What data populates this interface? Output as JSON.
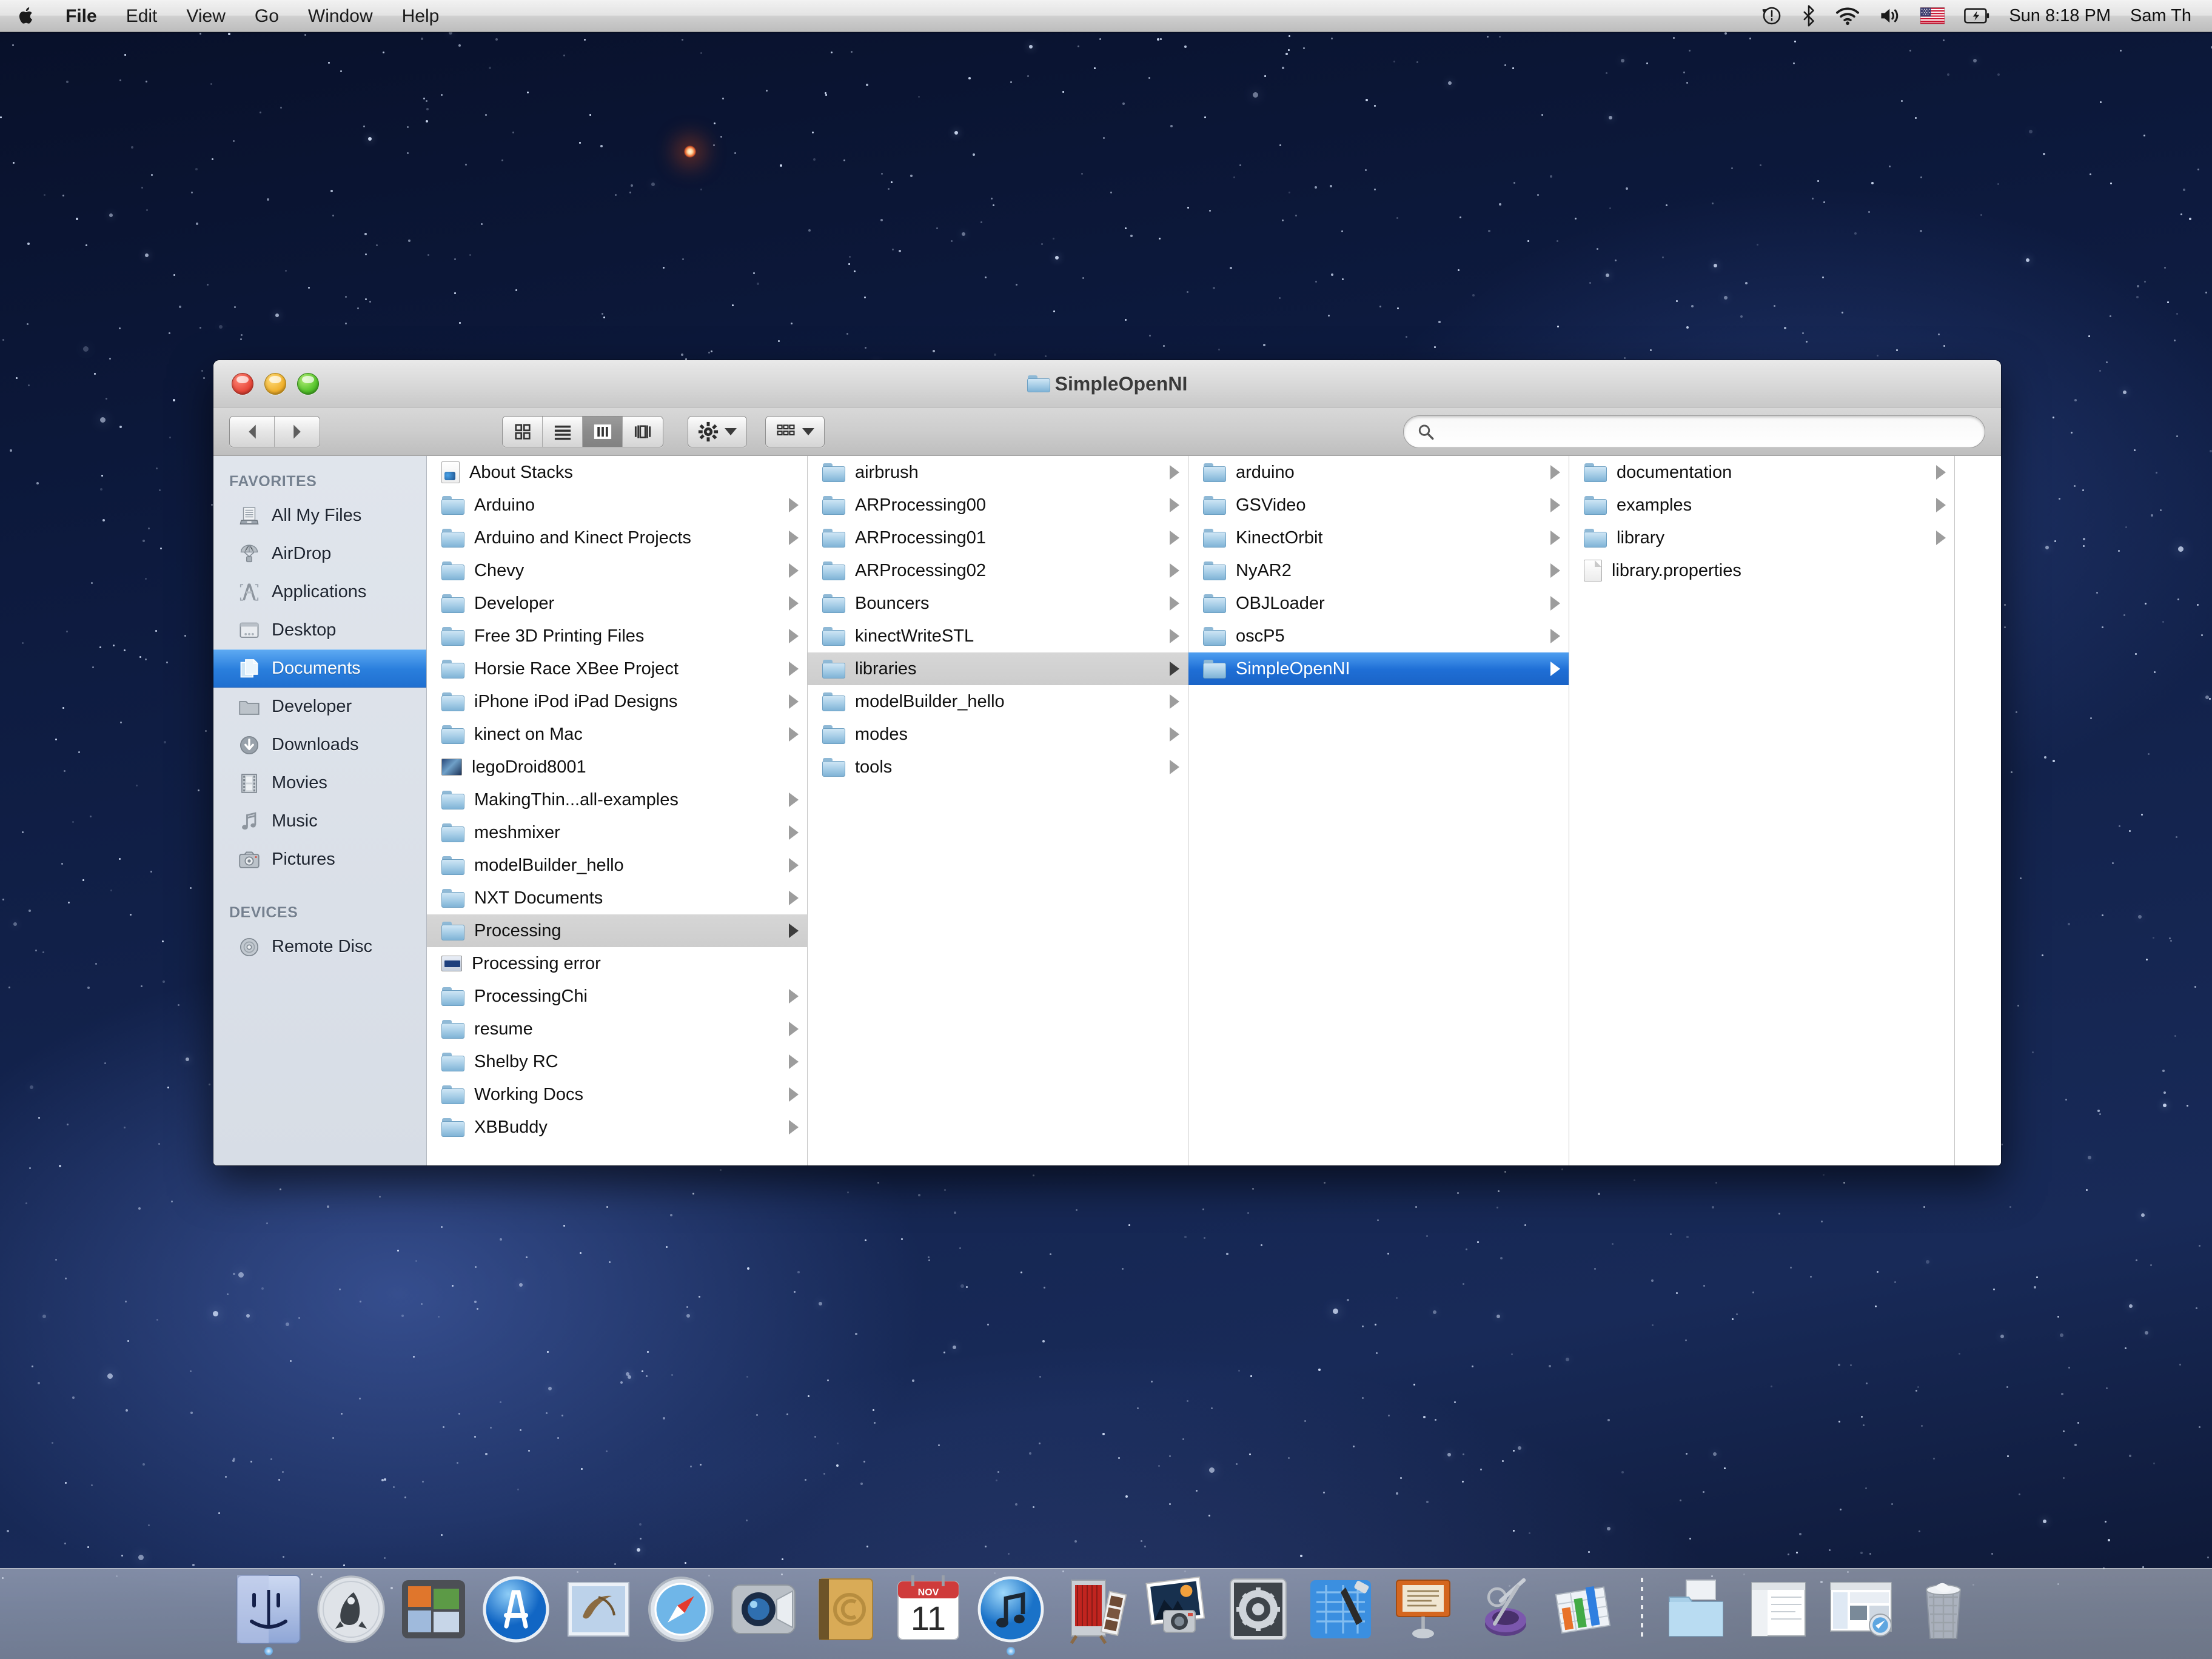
{
  "menubar": {
    "apple_icon": "apple-logo-icon",
    "items": [
      {
        "label": "File",
        "bold": true
      },
      {
        "label": "Edit",
        "bold": false
      },
      {
        "label": "View",
        "bold": false
      },
      {
        "label": "Go",
        "bold": false
      },
      {
        "label": "Window",
        "bold": false
      },
      {
        "label": "Help",
        "bold": false
      }
    ],
    "status_icons": [
      "timemachine-icon",
      "bluetooth-icon",
      "wifi-icon",
      "volume-icon",
      "us-flag-input-icon",
      "battery-icon"
    ],
    "clock": "Sun 8:18 PM",
    "user": "Sam Th"
  },
  "window": {
    "title": "SimpleOpenNI",
    "title_icon": "folder-icon",
    "traffic_lights": [
      "close-button",
      "minimize-button",
      "zoom-button"
    ]
  },
  "toolbar": {
    "back_label": "Back",
    "forward_label": "Forward",
    "view_modes": [
      {
        "name": "icon-view",
        "active": false
      },
      {
        "name": "list-view",
        "active": false
      },
      {
        "name": "column-view",
        "active": true
      },
      {
        "name": "coverflow-view",
        "active": false
      }
    ],
    "action_menu_label": "Action",
    "arrange_menu_label": "Arrange"
  },
  "search": {
    "value": "",
    "placeholder": ""
  },
  "sidebar": {
    "sections": [
      {
        "header": "FAVORITES",
        "items": [
          {
            "label": "All My Files",
            "icon": "all-my-files-icon",
            "selected": false
          },
          {
            "label": "AirDrop",
            "icon": "airdrop-icon",
            "selected": false
          },
          {
            "label": "Applications",
            "icon": "applications-icon",
            "selected": false
          },
          {
            "label": "Desktop",
            "icon": "desktop-icon",
            "selected": false
          },
          {
            "label": "Documents",
            "icon": "documents-icon",
            "selected": true
          },
          {
            "label": "Developer",
            "icon": "folder-icon",
            "selected": false
          },
          {
            "label": "Downloads",
            "icon": "downloads-icon",
            "selected": false
          },
          {
            "label": "Movies",
            "icon": "movies-icon",
            "selected": false
          },
          {
            "label": "Music",
            "icon": "music-icon",
            "selected": false
          },
          {
            "label": "Pictures",
            "icon": "pictures-icon",
            "selected": false
          }
        ]
      },
      {
        "header": "DEVICES",
        "items": [
          {
            "label": "Remote Disc",
            "icon": "remote-disc-icon",
            "selected": false
          }
        ]
      }
    ]
  },
  "columns": [
    {
      "name": "column-documents",
      "items": [
        {
          "label": "About Stacks",
          "icon": "stacks-doc-icon",
          "arrow": false,
          "state": "none"
        },
        {
          "label": "Arduino",
          "icon": "folder-icon",
          "arrow": true,
          "state": "none"
        },
        {
          "label": "Arduino and Kinect Projects",
          "icon": "folder-icon",
          "arrow": true,
          "state": "none"
        },
        {
          "label": "Chevy",
          "icon": "folder-icon",
          "arrow": true,
          "state": "none"
        },
        {
          "label": "Developer",
          "icon": "folder-icon",
          "arrow": true,
          "state": "none"
        },
        {
          "label": "Free 3D Printing Files",
          "icon": "folder-icon",
          "arrow": true,
          "state": "none"
        },
        {
          "label": "Horsie Race XBee Project",
          "icon": "folder-icon",
          "arrow": true,
          "state": "none"
        },
        {
          "label": "iPhone iPod iPad Designs",
          "icon": "folder-icon",
          "arrow": true,
          "state": "none"
        },
        {
          "label": "kinect on Mac",
          "icon": "folder-icon",
          "arrow": true,
          "state": "none"
        },
        {
          "label": "legoDroid8001",
          "icon": "image-thumb-icon",
          "arrow": false,
          "state": "none"
        },
        {
          "label": "MakingThin...all-examples",
          "icon": "folder-icon",
          "arrow": true,
          "state": "none"
        },
        {
          "label": "meshmixer",
          "icon": "folder-icon",
          "arrow": true,
          "state": "none"
        },
        {
          "label": "modelBuilder_hello",
          "icon": "folder-icon",
          "arrow": true,
          "state": "none"
        },
        {
          "label": "NXT Documents",
          "icon": "folder-icon",
          "arrow": true,
          "state": "none"
        },
        {
          "label": "Processing",
          "icon": "folder-icon",
          "arrow": true,
          "state": "selected-inactive"
        },
        {
          "label": "Processing error",
          "icon": "error-doc-icon",
          "arrow": false,
          "state": "none"
        },
        {
          "label": "ProcessingChi",
          "icon": "folder-icon",
          "arrow": true,
          "state": "none"
        },
        {
          "label": "resume",
          "icon": "folder-icon",
          "arrow": true,
          "state": "none"
        },
        {
          "label": "Shelby RC",
          "icon": "folder-icon",
          "arrow": true,
          "state": "none"
        },
        {
          "label": "Working Docs",
          "icon": "folder-icon",
          "arrow": true,
          "state": "none"
        },
        {
          "label": "XBBuddy",
          "icon": "folder-icon",
          "arrow": true,
          "state": "none"
        }
      ]
    },
    {
      "name": "column-processing",
      "items": [
        {
          "label": "airbrush",
          "icon": "folder-icon",
          "arrow": true,
          "state": "none"
        },
        {
          "label": "ARProcessing00",
          "icon": "folder-icon",
          "arrow": true,
          "state": "none"
        },
        {
          "label": "ARProcessing01",
          "icon": "folder-icon",
          "arrow": true,
          "state": "none"
        },
        {
          "label": "ARProcessing02",
          "icon": "folder-icon",
          "arrow": true,
          "state": "none"
        },
        {
          "label": "Bouncers",
          "icon": "folder-icon",
          "arrow": true,
          "state": "none"
        },
        {
          "label": "kinectWriteSTL",
          "icon": "folder-icon",
          "arrow": true,
          "state": "none"
        },
        {
          "label": "libraries",
          "icon": "folder-icon",
          "arrow": true,
          "state": "selected-inactive"
        },
        {
          "label": "modelBuilder_hello",
          "icon": "folder-icon",
          "arrow": true,
          "state": "none"
        },
        {
          "label": "modes",
          "icon": "folder-icon",
          "arrow": true,
          "state": "none"
        },
        {
          "label": "tools",
          "icon": "folder-icon",
          "arrow": true,
          "state": "none"
        }
      ]
    },
    {
      "name": "column-libraries",
      "items": [
        {
          "label": "arduino",
          "icon": "folder-icon",
          "arrow": true,
          "state": "none"
        },
        {
          "label": "GSVideo",
          "icon": "folder-icon",
          "arrow": true,
          "state": "none"
        },
        {
          "label": "KinectOrbit",
          "icon": "folder-icon",
          "arrow": true,
          "state": "none"
        },
        {
          "label": "NyAR2",
          "icon": "folder-icon",
          "arrow": true,
          "state": "none"
        },
        {
          "label": "OBJLoader",
          "icon": "folder-icon",
          "arrow": true,
          "state": "none"
        },
        {
          "label": "oscP5",
          "icon": "folder-icon",
          "arrow": true,
          "state": "none"
        },
        {
          "label": "SimpleOpenNI",
          "icon": "folder-icon",
          "arrow": true,
          "state": "selected-active"
        }
      ]
    },
    {
      "name": "column-simpleopenni",
      "items": [
        {
          "label": "documentation",
          "icon": "folder-icon",
          "arrow": true,
          "state": "none"
        },
        {
          "label": "examples",
          "icon": "folder-icon",
          "arrow": true,
          "state": "none"
        },
        {
          "label": "library",
          "icon": "folder-icon",
          "arrow": true,
          "state": "none"
        },
        {
          "label": "library.properties",
          "icon": "doc-icon",
          "arrow": false,
          "state": "none"
        }
      ]
    }
  ],
  "dock": {
    "items": [
      {
        "name": "finder",
        "label": "Finder",
        "running": true
      },
      {
        "name": "launchpad",
        "label": "Launchpad",
        "running": false
      },
      {
        "name": "mission-control",
        "label": "Mission Control",
        "running": false
      },
      {
        "name": "app-store",
        "label": "App Store",
        "running": false
      },
      {
        "name": "mail",
        "label": "Mail",
        "running": false
      },
      {
        "name": "safari",
        "label": "Safari",
        "running": false
      },
      {
        "name": "facetime",
        "label": "FaceTime",
        "running": false
      },
      {
        "name": "address-book",
        "label": "Address Book",
        "running": false
      },
      {
        "name": "calendar",
        "label": "Calendar",
        "running": false,
        "month": "NOV",
        "day": "11"
      },
      {
        "name": "itunes",
        "label": "iTunes",
        "running": true
      },
      {
        "name": "photo-booth",
        "label": "Photo Booth",
        "running": false
      },
      {
        "name": "iphoto",
        "label": "iPhoto",
        "running": false
      },
      {
        "name": "system-preferences",
        "label": "System Preferences",
        "running": false
      },
      {
        "name": "xcode",
        "label": "Xcode",
        "running": false
      },
      {
        "name": "keynote",
        "label": "Keynote",
        "running": false
      },
      {
        "name": "processing",
        "label": "Processing",
        "running": false
      },
      {
        "name": "numbers",
        "label": "Numbers",
        "running": false
      },
      {
        "name": "separator",
        "label": "",
        "running": false
      },
      {
        "name": "documents-stack",
        "label": "Documents",
        "running": false
      },
      {
        "name": "minimized-window-1",
        "label": "Window",
        "running": false
      },
      {
        "name": "minimized-window-2",
        "label": "Window",
        "running": false
      },
      {
        "name": "trash",
        "label": "Trash",
        "running": false
      }
    ]
  },
  "colors": {
    "selection_blue": "#1f6fd6",
    "selection_gray": "#d2d2d2",
    "folder_blue": "#a9cfe8",
    "desktop_navy": "#13234d"
  }
}
